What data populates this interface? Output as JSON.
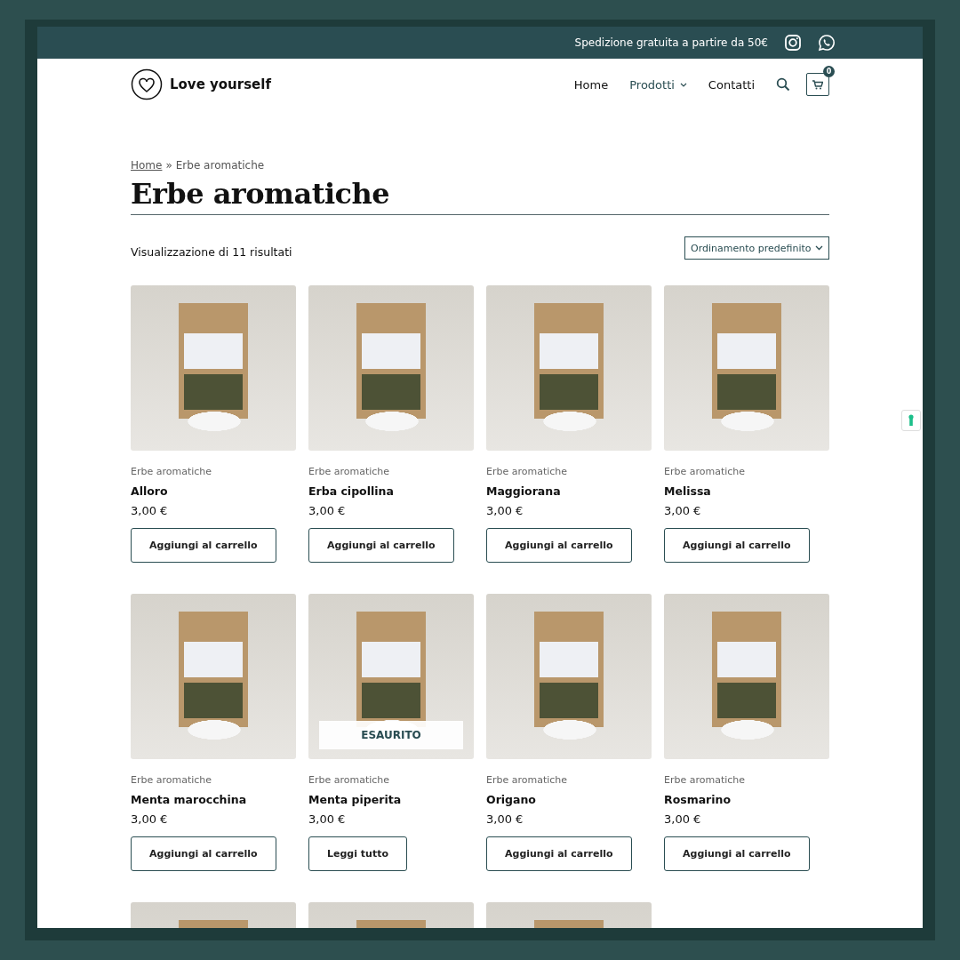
{
  "top_bar": {
    "text": "Spedizione gratuita a partire da 50€"
  },
  "header": {
    "logo_text": "Love yourself",
    "nav": [
      {
        "label": "Home",
        "selected": false,
        "dropdown": false
      },
      {
        "label": "Prodotti",
        "selected": true,
        "dropdown": true
      },
      {
        "label": "Contatti",
        "selected": false,
        "dropdown": false
      }
    ],
    "cart_count": "0"
  },
  "breadcrumb": {
    "link": "Home",
    "separator": "»",
    "current": "Erbe aromatiche"
  },
  "title": "Erbe aromatiche",
  "results": "Visualizzazione di 11 risultati",
  "sort": {
    "value": "Ordinamento predefinito"
  },
  "products": [
    {
      "kind": "full",
      "category": "Erbe aromatiche",
      "name": "Alloro",
      "price": "3,00 €",
      "button": "Aggiungi al carrello"
    },
    {
      "kind": "full",
      "category": "Erbe aromatiche",
      "name": "Erba cipollina",
      "price": "3,00 €",
      "button": "Aggiungi al carrello"
    },
    {
      "kind": "full",
      "category": "Erbe aromatiche",
      "name": "Maggiorana",
      "price": "3,00 €",
      "button": "Aggiungi al carrello"
    },
    {
      "kind": "full",
      "category": "Erbe aromatiche",
      "name": "Melissa",
      "price": "3,00 €",
      "button": "Aggiungi al carrello"
    },
    {
      "kind": "full",
      "category": "Erbe aromatiche",
      "name": "Menta marocchina",
      "price": "3,00 €",
      "button": "Aggiungi al carrello"
    },
    {
      "kind": "full",
      "category": "Erbe aromatiche",
      "name": "Menta piperita",
      "price": "3,00 €",
      "button": "Leggi tutto",
      "badge": "ESAURITO"
    },
    {
      "kind": "full",
      "category": "Erbe aromatiche",
      "name": "Origano",
      "price": "3,00 €",
      "button": "Aggiungi al carrello"
    },
    {
      "kind": "full",
      "category": "Erbe aromatiche",
      "name": "Rosmarino",
      "price": "3,00 €",
      "button": "Aggiungi al carrello"
    },
    {
      "kind": "photo_only"
    },
    {
      "kind": "photo_only"
    },
    {
      "kind": "photo_only"
    }
  ]
}
